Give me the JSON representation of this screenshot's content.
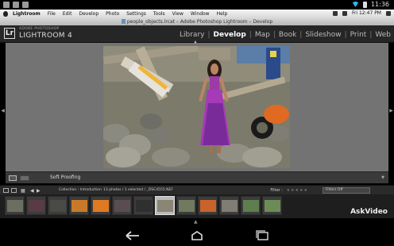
{
  "status_bar": {
    "date": "Fri 12:47 PM",
    "time": "11:36"
  },
  "mac_menu": {
    "items": [
      "Lightroom",
      "File",
      "Edit",
      "Develop",
      "Photo",
      "Settings",
      "Tools",
      "View",
      "Window",
      "Help"
    ]
  },
  "window": {
    "title": "people_objects.lrcat – Adobe Photoshop Lightroom – Develop"
  },
  "lightroom": {
    "brand_small": "ADOBE PHOTOSHOP",
    "brand": "LIGHTROOM 4",
    "logo": "Lr",
    "modules": [
      "Library",
      "Develop",
      "Map",
      "Book",
      "Slideshow",
      "Print",
      "Web"
    ],
    "active_module": "Develop"
  },
  "toolbar": {
    "soft_proofing_label": "Soft Proofing"
  },
  "filmstrip_bar": {
    "collection": "Collection : Introduction",
    "photo_count": "13 photos / 1 selected / _DSC4555.NEF",
    "filter_label": "Filter :",
    "filter_value": "Filters Off"
  },
  "thumbnails": [
    {
      "color": "#6b6f62",
      "selected": false
    },
    {
      "color": "#5a3b44",
      "selected": false
    },
    {
      "color": "#4a4a46",
      "selected": false
    },
    {
      "color": "#c87a2a",
      "selected": false
    },
    {
      "color": "#e07a22",
      "selected": false
    },
    {
      "color": "#5a4d52",
      "selected": false
    },
    {
      "color": "#2f2f2f",
      "selected": false
    },
    {
      "color": "#8a8575",
      "selected": true
    },
    {
      "color": "#6f7a5e",
      "selected": false
    },
    {
      "color": "#c9632b",
      "selected": false
    },
    {
      "color": "#7f7d74",
      "selected": false
    },
    {
      "color": "#5e7e4e",
      "selected": false
    },
    {
      "color": "#6c8c56",
      "selected": false
    }
  ],
  "watermark": "AskVideo",
  "colors": {
    "accent_wifi": "#2fb7e8",
    "panel_bg": "#737373",
    "header_bg": "#262626"
  }
}
